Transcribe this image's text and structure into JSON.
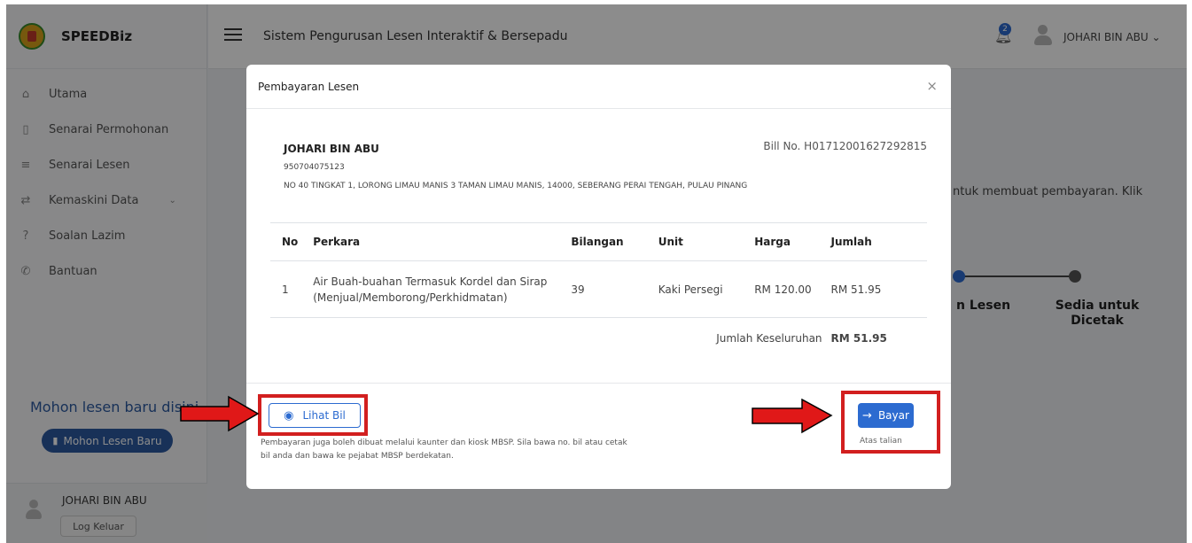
{
  "brand": {
    "name": "SPEEDBiz"
  },
  "sidebar": {
    "items": [
      {
        "label": "Utama",
        "icon": "home-icon"
      },
      {
        "label": "Senarai Permohonan",
        "icon": "file-icon"
      },
      {
        "label": "Senarai Lesen",
        "icon": "list-icon"
      },
      {
        "label": "Kemaskini Data",
        "icon": "refresh-icon"
      },
      {
        "label": "Soalan Lazim",
        "icon": "question-icon"
      },
      {
        "label": "Bantuan",
        "icon": "phone-icon"
      }
    ],
    "promo_title": "Mohon lesen baru disini",
    "promo_button": "Mohon Lesen Baru",
    "user_name": "JOHARI BIN ABU",
    "logout_label": "Log Keluar"
  },
  "topbar": {
    "title": "Sistem Pengurusan Lesen Interaktif & Bersepadu",
    "notification_count": "2",
    "user_name": "JOHARI BIN ABU"
  },
  "main": {
    "instruction_fragment": "ntuk membuat pembayaran. Klik",
    "steps": [
      "n Lesen",
      "Sedia untuk Dicetak"
    ]
  },
  "modal": {
    "title": "Pembayaran Lesen",
    "close_symbol": "×",
    "payer_name": "JOHARI BIN ABU",
    "bill_no": "Bill No. H01712001627292815",
    "payer_ic": "950704075123",
    "payer_address": "NO 40 TINGKAT 1, LORONG LIMAU MANIS 3 TAMAN LIMAU MANIS, 14000, SEBERANG PERAI TENGAH, PULAU PINANG",
    "table": {
      "headers": [
        "No",
        "Perkara",
        "Bilangan",
        "Unit",
        "Harga",
        "Jumlah"
      ],
      "rows": [
        [
          "1",
          "Air Buah-buahan Termasuk Kordel dan Sirap (Menjual/Memborong/Perkhidmatan)",
          "39",
          "Kaki Persegi",
          "RM 120.00",
          "RM 51.95"
        ]
      ],
      "total_label": "Jumlah Keseluruhan",
      "total_value": "RM 51.95"
    },
    "view_bill_label": "Lihat Bil",
    "payment_note": "Pembayaran juga boleh dibuat melalui kaunter dan kiosk MBSP. Sila bawa no. bil atau cetak bil anda dan bawa ke pejabat MBSP berdekatan.",
    "pay_label": "Bayar",
    "pay_sub": "Atas talian"
  },
  "colors": {
    "accent": "#2c6bd0",
    "annotation": "#d21f1f"
  }
}
